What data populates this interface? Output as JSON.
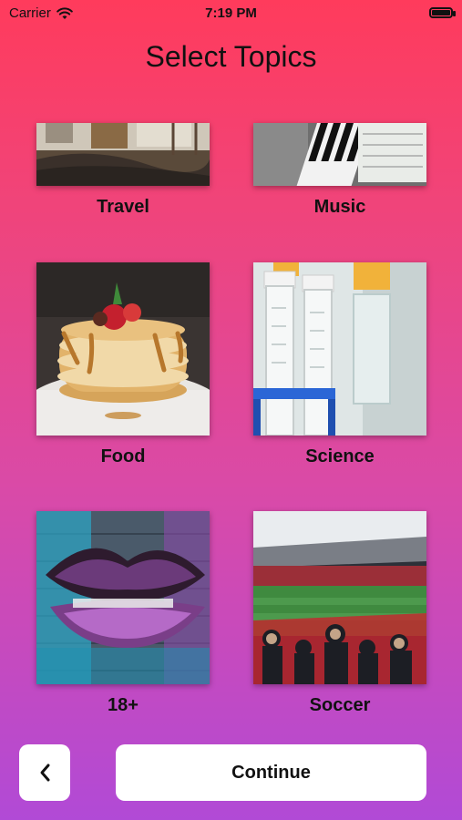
{
  "status_bar": {
    "carrier": "Carrier",
    "time": "7:19 PM"
  },
  "title": "Select Topics",
  "topics": [
    {
      "label": "Travel"
    },
    {
      "label": "Music"
    },
    {
      "label": "Food"
    },
    {
      "label": "Science"
    },
    {
      "label": "18+"
    },
    {
      "label": "Soccer"
    }
  ],
  "footer": {
    "continue_label": "Continue",
    "back_icon": "chevron-left-icon"
  },
  "colors": {
    "gradient_top": "#ff3b5c",
    "gradient_bottom": "#b14ad6"
  }
}
